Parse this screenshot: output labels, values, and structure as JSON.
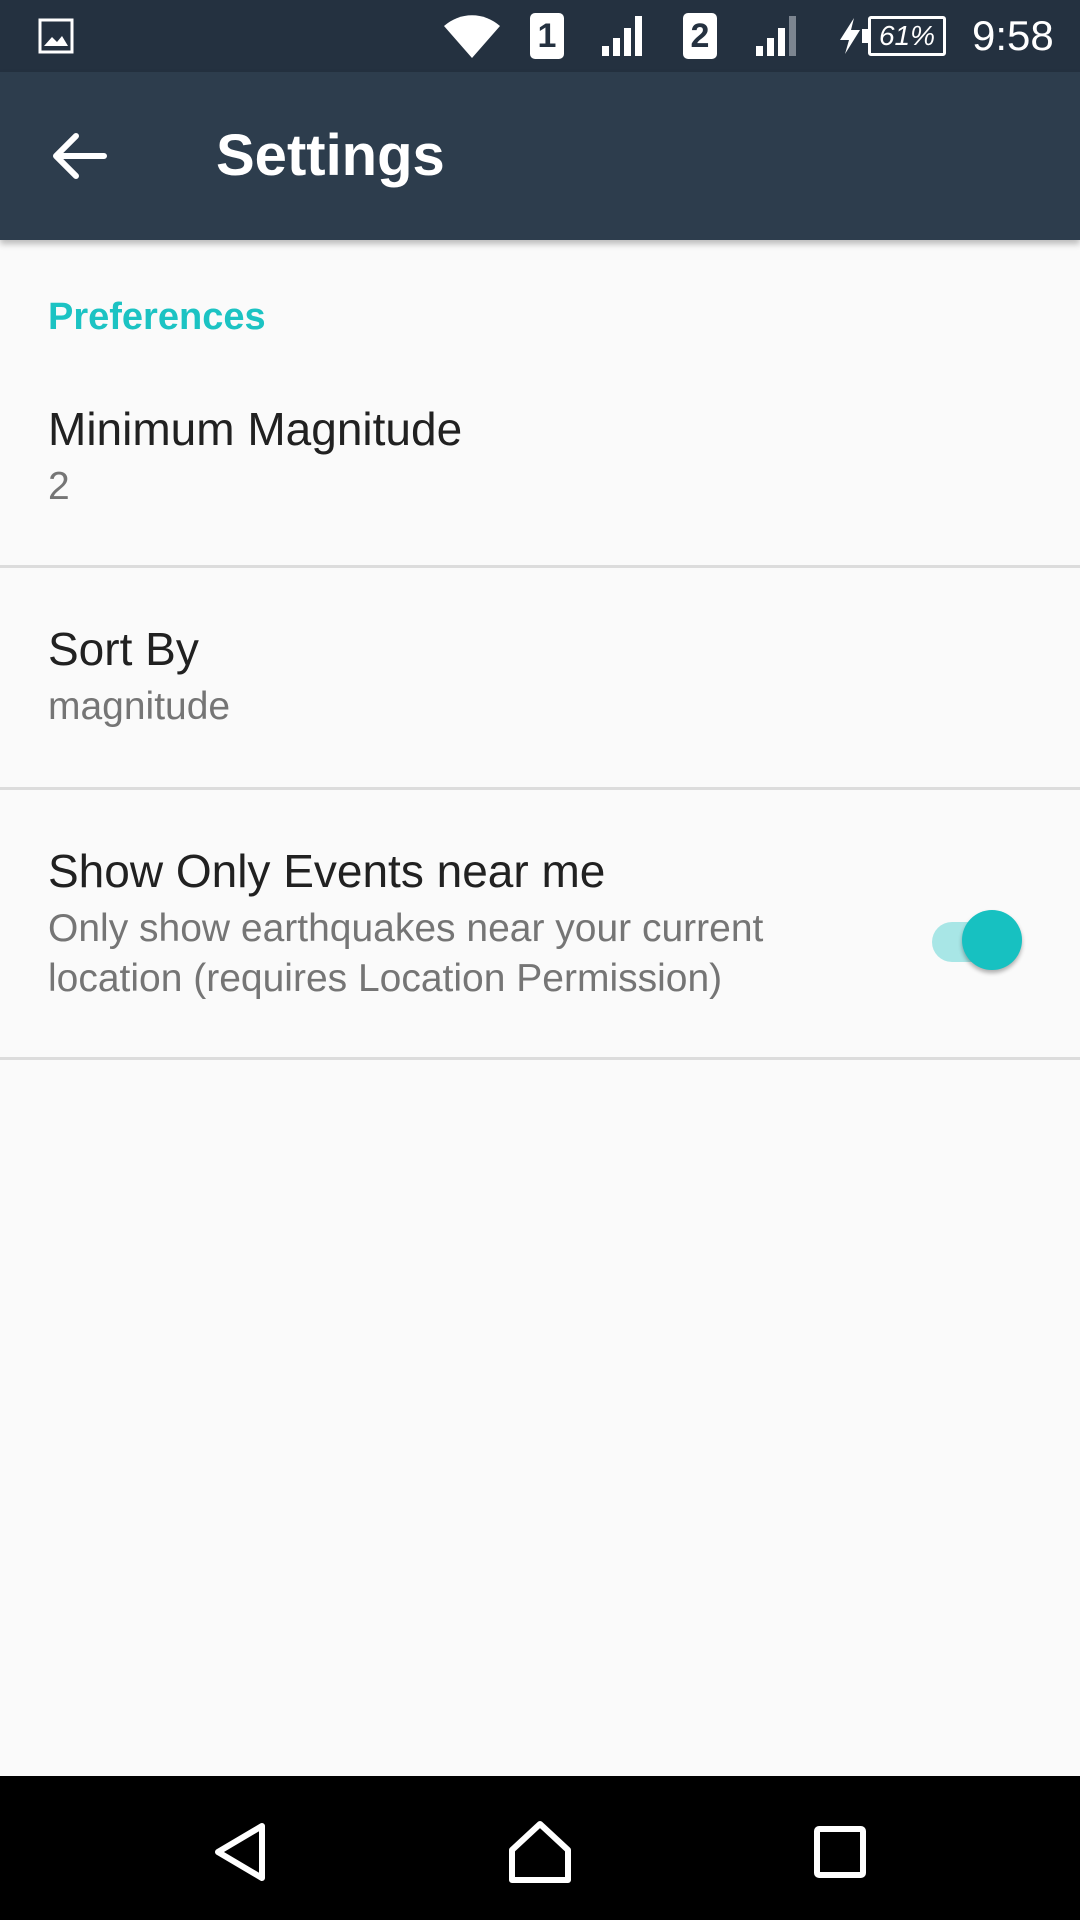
{
  "status_bar": {
    "time": "9:58",
    "battery_percent": "61%",
    "sim1_label": "1",
    "sim2_label": "2",
    "icons": [
      "gallery-icon",
      "wifi-icon",
      "sim1-icon",
      "signal-icon",
      "sim2-icon",
      "signal-icon",
      "charging-icon",
      "battery-icon"
    ]
  },
  "app_bar": {
    "title": "Settings",
    "back_icon": "arrow-back-icon"
  },
  "preferences": {
    "category_title": "Preferences",
    "items": [
      {
        "title": "Minimum Magnitude",
        "summary": "2"
      },
      {
        "title": "Sort By",
        "summary": "magnitude"
      },
      {
        "title": "Show Only Events near me",
        "summary": "Only show earthquakes near your current location (requires Location Permission)",
        "toggle_on": true
      }
    ]
  },
  "nav_bar": {
    "icons": [
      "nav-back-icon",
      "nav-home-icon",
      "nav-recent-icon"
    ]
  },
  "colors": {
    "status_bar": "#243140",
    "app_bar": "#2d3d4d",
    "accent": "#1cc3c3",
    "background": "#fafafa"
  }
}
